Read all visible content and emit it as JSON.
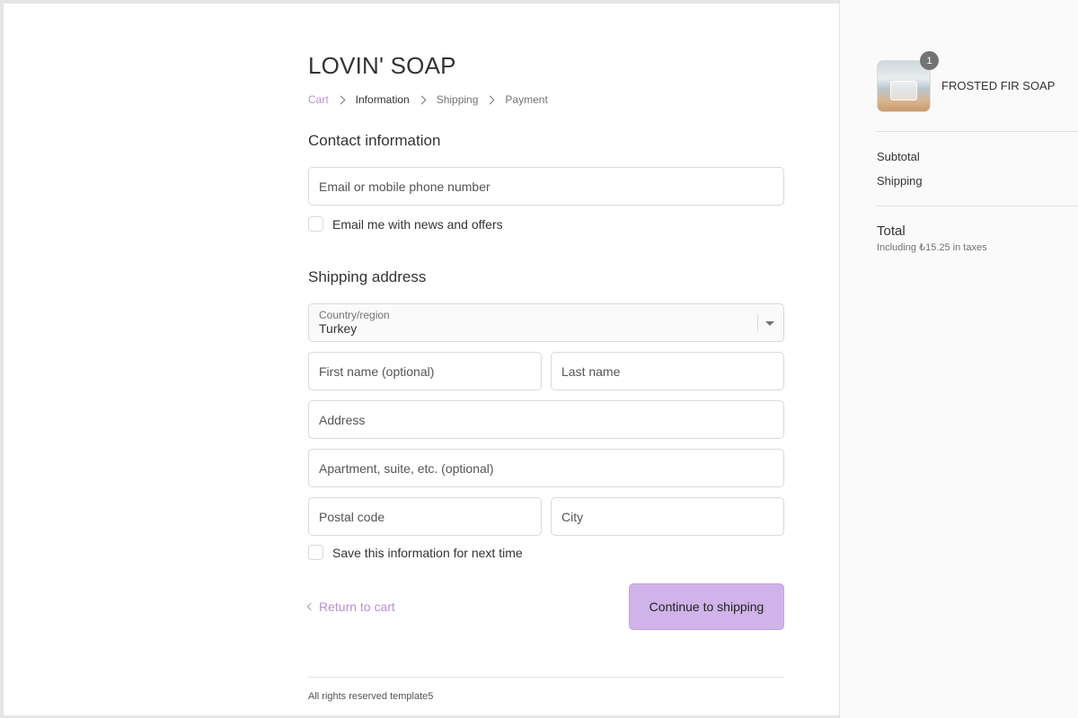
{
  "store": {
    "name": "LOVIN' SOAP"
  },
  "breadcrumb": {
    "items": [
      {
        "label": "Cart",
        "state": "link"
      },
      {
        "label": "Information",
        "state": "current"
      },
      {
        "label": "Shipping",
        "state": "upcoming"
      },
      {
        "label": "Payment",
        "state": "upcoming"
      }
    ]
  },
  "contact": {
    "title": "Contact information",
    "email_placeholder": "Email or mobile phone number",
    "email_value": "",
    "newsletter_label": "Email me with news and offers",
    "newsletter_checked": false
  },
  "shipping": {
    "title": "Shipping address",
    "country_label": "Country/region",
    "country_value": "Turkey",
    "first_name_placeholder": "First name (optional)",
    "last_name_placeholder": "Last name",
    "address_placeholder": "Address",
    "apartment_placeholder": "Apartment, suite, etc. (optional)",
    "postal_placeholder": "Postal code",
    "city_placeholder": "City",
    "save_info_label": "Save this information for next time",
    "save_info_checked": false
  },
  "actions": {
    "return_label": "Return to cart",
    "continue_label": "Continue to shipping"
  },
  "footer": {
    "text": "All rights reserved template5"
  },
  "summary": {
    "product": {
      "name": "FROSTED FIR SOAP",
      "quantity": "1"
    },
    "subtotal_label": "Subtotal",
    "shipping_label": "Shipping",
    "total_label": "Total",
    "tax_note": "Including ₺15.25 in taxes"
  },
  "colors": {
    "accent": "#b590d6",
    "button_bg": "#d0b3e8",
    "sidebar_bg": "#fafafa",
    "border": "#d9d9d9"
  },
  "icons": {
    "breadcrumb_separator": "chevron-right-icon",
    "back": "chevron-left-icon",
    "select": "caret-down-icon"
  }
}
